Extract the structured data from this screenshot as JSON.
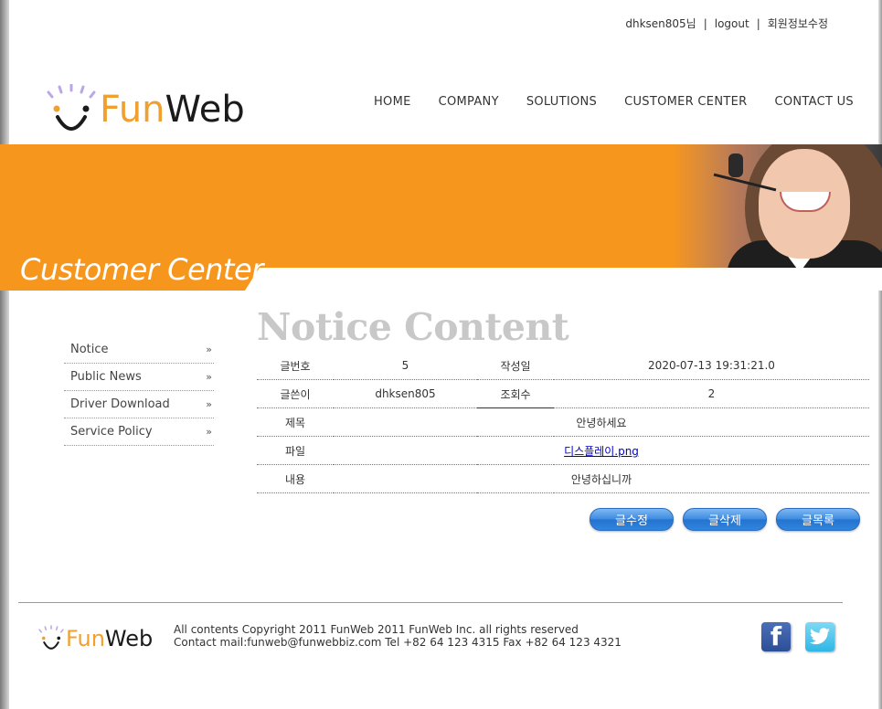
{
  "userbar": {
    "user": "dhksen805님",
    "sep1": "|",
    "logout": "logout",
    "sep2": "|",
    "edit_profile": "회원정보수정"
  },
  "logo": {
    "fun": "Fun",
    "web": "Web"
  },
  "nav": {
    "items": [
      "HOME",
      "COMPANY",
      "SOLUTIONS",
      "CUSTOMER CENTER",
      "CONTACT US"
    ]
  },
  "banner": {
    "title": "Customer Center"
  },
  "sidemenu": {
    "items": [
      "Notice",
      "Public News",
      "Driver Download",
      "Service Policy"
    ],
    "arrow": "»"
  },
  "content": {
    "title": "Notice Content",
    "labels": {
      "num": "글번호",
      "date": "작성일",
      "writer": "글쓴이",
      "views": "조회수",
      "subject": "제목",
      "file": "파일",
      "body": "내용"
    },
    "values": {
      "num": "5",
      "date": "2020-07-13 19:31:21.0",
      "writer": "dhksen805",
      "views": "2",
      "subject": "안녕하세요",
      "file": "디스플레이.png",
      "body": "안녕하십니까"
    },
    "buttons": {
      "edit": "글수정",
      "delete": "글삭제",
      "list": "글목록"
    }
  },
  "footer": {
    "line1": "All contents Copyright 2011 FunWeb 2011 FunWeb Inc. all rights reserved",
    "line2": "Contact mail:funweb@funwebbiz.com Tel +82 64 123 4315 Fax +82 64 123 4321",
    "facebook_glyph": "f",
    "icons": [
      "facebook-icon",
      "twitter-icon"
    ]
  },
  "colors": {
    "accent": "#f7961d",
    "button": "#2f86de",
    "title_gray": "#c8c8c8"
  }
}
